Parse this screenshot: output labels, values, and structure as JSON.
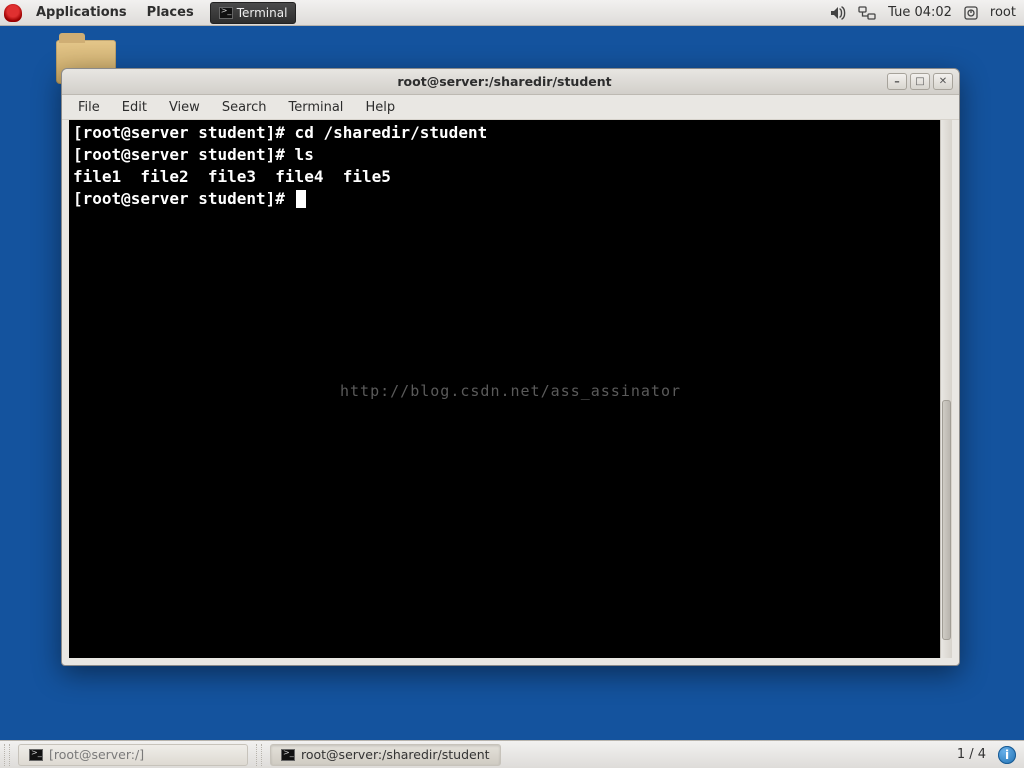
{
  "top_panel": {
    "applications": "Applications",
    "places": "Places",
    "running_app": "Terminal",
    "clock": "Tue 04:02",
    "user": "root"
  },
  "window": {
    "title": "root@server:/sharedir/student",
    "menus": {
      "file": "File",
      "edit": "Edit",
      "view": "View",
      "search": "Search",
      "terminal": "Terminal",
      "help": "Help"
    }
  },
  "terminal": {
    "line1": "[root@server student]# cd /sharedir/student",
    "line2": "[root@server student]# ls",
    "line3": "file1  file2  file3  file4  file5",
    "prompt": "[root@server student]# "
  },
  "watermark": "http://blog.csdn.net/ass_assinator",
  "bottom_panel": {
    "task1": "[root@server:/]",
    "task2": "root@server:/sharedir/student",
    "workspace": "1 / 4"
  }
}
